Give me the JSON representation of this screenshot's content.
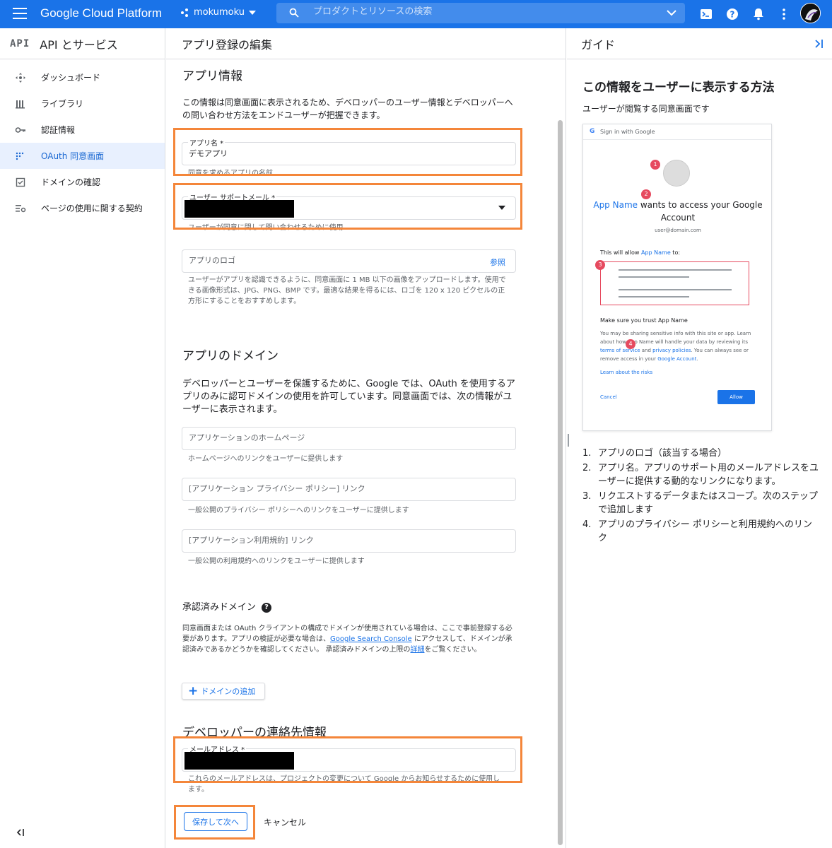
{
  "topbar": {
    "brand": "Google Cloud Platform",
    "project": "mokumoku",
    "search_placeholder": "プロダクトとリソースの検索",
    "accent": "#1a73e8",
    "icons": [
      "menu-icon",
      "cloud-shell-icon",
      "help-icon",
      "notifications-icon",
      "more-vert-icon"
    ]
  },
  "sidebar": {
    "logo": "API",
    "title": "API とサービス",
    "items": [
      {
        "label": "ダッシュボード",
        "icon": "dashboard-icon"
      },
      {
        "label": "ライブラリ",
        "icon": "library-icon"
      },
      {
        "label": "認証情報",
        "icon": "key-icon"
      },
      {
        "label": "OAuth 同意画面",
        "icon": "consent-icon",
        "active": true
      },
      {
        "label": "ドメインの確認",
        "icon": "checkbox-icon"
      },
      {
        "label": "ページの使用に関する契約",
        "icon": "settings-list-icon"
      }
    ]
  },
  "main": {
    "header": "アプリ登録の編集",
    "app_info": {
      "title": "アプリ情報",
      "description": "この情報は同意画面に表示されるため、デベロッパーのユーザー情報とデベロッパーへの問い合わせ方法をエンドユーザーが把握できます。",
      "app_name_label": "アプリ名 *",
      "app_name_value": "デモアプリ",
      "app_name_hint": "同意を求めるアプリの名前",
      "support_email_label": "ユーザー サポートメール *",
      "support_email_hint": "ユーザーが同意に関して問い合わせるために使用",
      "logo_placeholder": "アプリのロゴ",
      "logo_browse": "参照",
      "logo_hint": "ユーザーがアプリを認識できるように、同意画面に 1 MB 以下の画像をアップロードします。使用できる画像形式は、JPG、PNG、BMP です。最適な結果を得るには、ロゴを 120 x 120 ピクセルの正方形にすることをおすすめします。"
    },
    "app_domain": {
      "title": "アプリのドメイン",
      "description": "デベロッパーとユーザーを保護するために、Google では、OAuth を使用するアプリのみに認可ドメインの使用を許可しています。同意画面では、次の情報がユーザーに表示されます。",
      "homepage_placeholder": "アプリケーションのホームページ",
      "homepage_hint": "ホームページへのリンクをユーザーに提供します",
      "privacy_placeholder": "[アプリケーション プライバシー ポリシー] リンク",
      "privacy_hint": "一般公開のプライバシー ポリシーへのリンクをユーザーに提供します",
      "tos_placeholder": "[アプリケーション利用規約] リンク",
      "tos_hint": "一般公開の利用規約へのリンクをユーザーに提供します"
    },
    "authorized_domains": {
      "title": "承認済みドメイン",
      "text_1": "同意画面または OAuth クライアントの構成でドメインが使用されている場合は、ここで事前登録する必要があります。アプリの検証が必要な場合は、",
      "link_1": "Google Search Console",
      "text_2": " にアクセスして、ドメインが承認済みであるかどうかを確認してください。 承認済みドメインの上限の",
      "link_2": "詳細",
      "text_3": "をご覧ください。",
      "add_button": "ドメインの追加"
    },
    "developer_contact": {
      "title": "デベロッパーの連絡先情報",
      "email_label": "メールアドレス *",
      "email_hint": "これらのメールアドレスは、プロジェクトの変更について Google からお知らせするために使用します。"
    },
    "save_button": "保存して次へ",
    "cancel_button": "キャンセル",
    "highlight_color": "#f4863a"
  },
  "guide": {
    "header": "ガイド",
    "title": "この情報をユーザーに表示する方法",
    "subtitle": "ユーザーが閲覧する同意画面です",
    "mock": {
      "header": "Sign in with Google",
      "app_name": "App Name",
      "wants_access": " wants to access your Google Account",
      "email": "user@domain.com",
      "allow_prefix": "This will allow ",
      "allow_suffix": " to:",
      "trust": "Make sure you trust App Name",
      "fine_1": "You may be sharing sensitive info with this site or app. Learn about how App Name will handle your data by reviewing its ",
      "terms": "terms of service",
      "and": " and ",
      "privacy": "privacy policies",
      "fine_2": ". You can always see or remove access in your ",
      "account": "Google Account",
      "fine_3": ".",
      "risks": "Learn about the risks",
      "cancel": "Cancel",
      "allow": "Allow",
      "badges": [
        "1",
        "2",
        "3",
        "4"
      ]
    },
    "list": [
      {
        "n": "1.",
        "text": "アプリのロゴ（該当する場合）"
      },
      {
        "n": "2.",
        "text": "アプリ名。アプリのサポート用のメールアドレスをユーザーに提供する動的なリンクになります。"
      },
      {
        "n": "3.",
        "text": "リクエストするデータまたはスコープ。次のステップで追加します"
      },
      {
        "n": "4.",
        "text": "アプリのプライバシー ポリシーと利用規約へのリンク"
      }
    ]
  }
}
